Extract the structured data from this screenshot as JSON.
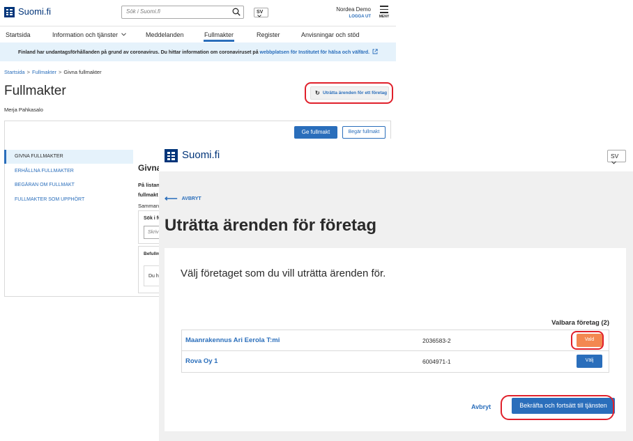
{
  "background_page": {
    "logo_text": "Suomi.fi",
    "search_placeholder": "Sök i Suomi.fi",
    "lang": "SV",
    "user_name": "Nordea Demo",
    "logout": "LOGGA UT",
    "menu_label": "MENY",
    "nav": [
      "Startsida",
      "Information och tjänster",
      "Meddelanden",
      "Fullmakter",
      "Register",
      "Anvisningar och stöd"
    ],
    "nav_active": "Fullmakter",
    "notice_text": "Finland har undantagsförhållanden på grund av coronavirus. Du hittar information om coronaviruset på ",
    "notice_link": "webbplatsen för Institutet för hälsa och välfärd.",
    "breadcrumb": [
      "Startsida",
      "Fullmakter",
      "Givna fullmakter"
    ],
    "title": "Fullmakter",
    "person": "Merja Pahkasalo",
    "action_button": "Uträtta ärenden för ett företag",
    "give_button": "Ge fullmakt",
    "request_button": "Begär fullmakt",
    "side_menu": [
      "GIVNA FULLMAKTER",
      "ERHÅLLNA FULLMAKTER",
      "BEGÄRAN OM FULLMAKT",
      "FULLMAKTER SOM UPPHÖRT"
    ],
    "fragments": {
      "heading": "Givna",
      "line1": "På listan",
      "line2": "fullmakt",
      "line3": "Samman",
      "search_label": "Sök i fu",
      "search_placeholder": "Skriv",
      "tab": "Befullm",
      "empty": "Du h"
    }
  },
  "modal_page": {
    "logo_text": "Suomi.fi",
    "lang": "SV",
    "back_label": "AVBRYT",
    "title": "Uträtta ärenden för företag",
    "lead": "Välj företaget som du vill uträtta ärenden för.",
    "count_label": "Valbara företag (2)",
    "companies": [
      {
        "name": "Maanrakennus Ari Eerola T:mi",
        "business_id": "2036583-2",
        "button": "Vald",
        "selected": true
      },
      {
        "name": "Rova Oy 1",
        "business_id": "6004971-1",
        "button": "Välj",
        "selected": false
      }
    ],
    "cancel_label": "Avbryt",
    "confirm_label": "Bekräfta och fortsätt till tjänsten"
  },
  "colors": {
    "brand": "#003479",
    "link": "#2a6ebb",
    "selected_button": "#f38851",
    "highlight": "#e0202b",
    "notice_bg": "#e5f2fb"
  },
  "icons": [
    "suomi-logo-icon",
    "search-icon",
    "chevron-down-icon",
    "menu-icon",
    "external-link-icon",
    "refresh-icon",
    "back-arrow-icon"
  ]
}
